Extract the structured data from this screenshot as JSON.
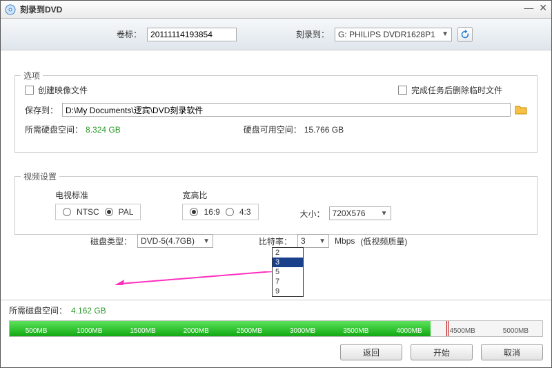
{
  "window": {
    "title": "刻录到DVD"
  },
  "top": {
    "volume_label": "卷标：",
    "volume_value": "20111114193854",
    "burn_to_label": "刻录到：",
    "burn_to_value": "G: PHILIPS  DVDR1628P1"
  },
  "options": {
    "legend": "选项",
    "create_image": "创建映像文件",
    "delete_temp": "完成任务后删除临时文件",
    "save_to_label": "保存到：",
    "save_to_value": "D:\\My Documents\\逻宾\\DVD刻录软件",
    "need_hd_label": "所需硬盘空间：",
    "need_hd_value": "8.324 GB",
    "avail_hd_label": "硬盘可用空间：",
    "avail_hd_value": "15.766 GB"
  },
  "video": {
    "legend": "视频设置",
    "tv_std_label": "电视标准",
    "ntsc": "NTSC",
    "pal": "PAL",
    "aspect_label": "宽高比",
    "a169": "16:9",
    "a43": "4:3",
    "size_label": "大小：",
    "size_value": "720X576"
  },
  "disc": {
    "type_label": "磁盘类型：",
    "type_value": "DVD-5(4.7GB)",
    "bitrate_label": "比特率：",
    "bitrate_value": "3",
    "mbps": "Mbps",
    "quality_note": "(低视频质量)",
    "options": [
      "2",
      "3",
      "5",
      "7",
      "9"
    ]
  },
  "bottom": {
    "need_disc_label": "所需磁盘空间：",
    "need_disc_value": "4.162 GB",
    "ticks": [
      "500MB",
      "1000MB",
      "1500MB",
      "2000MB",
      "2500MB",
      "3000MB",
      "3500MB",
      "4000MB",
      "4500MB",
      "5000MB"
    ]
  },
  "buttons": {
    "back": "返回",
    "start": "开始",
    "cancel": "取消"
  }
}
